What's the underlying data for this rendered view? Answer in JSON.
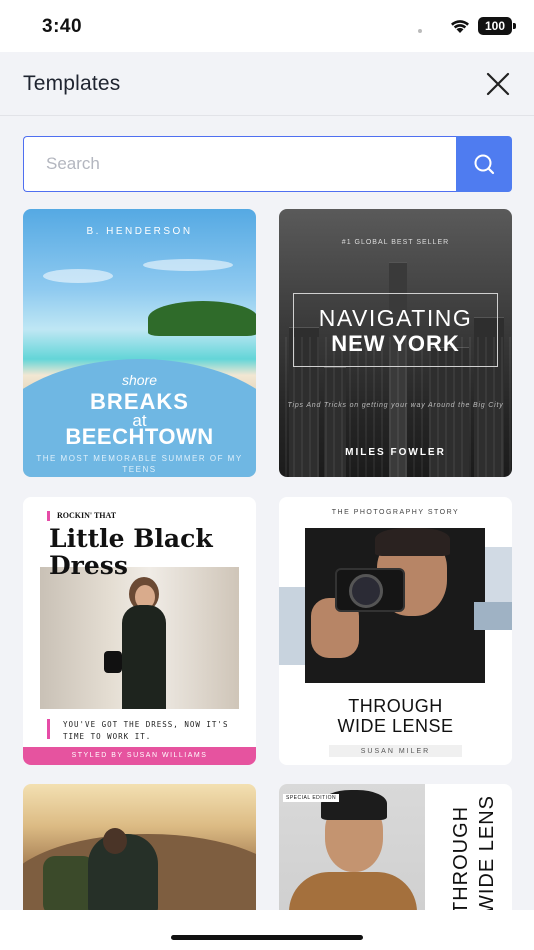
{
  "status_bar": {
    "time": "3:40",
    "battery": "100"
  },
  "header": {
    "title": "Templates"
  },
  "search": {
    "placeholder": "Search",
    "value": ""
  },
  "templates": [
    {
      "author": "B. HENDERSON",
      "line1": "shore",
      "line2": "BREAKS",
      "line3": "at",
      "line4": "BEECHTOWN",
      "tagline": "THE MOST MEMORABLE SUMMER OF MY TEENS"
    },
    {
      "kicker": "#1 GLOBAL BEST SELLER",
      "title1": "NAVIGATING",
      "title2": "NEW YORK",
      "subtitle": "Tips And Tricks on getting your way Around the Big City",
      "author": "MILES FOWLER"
    },
    {
      "kicker": "ROCKIN' THAT",
      "title": "Little Black Dress",
      "body": "YOU'VE GOT THE DRESS, NOW IT'S TIME TO WORK IT.",
      "footer": "STYLED BY SUSAN WILLIAMS"
    },
    {
      "kicker": "THE PHOTOGRAPHY STORY",
      "title1": "THROUGH",
      "title2": "WIDE LENSE",
      "author": "SUSAN MILER"
    },
    {},
    {
      "badge": "SPECIAL EDITION",
      "title1": "THROUGH",
      "title2": "WIDE LENSE"
    }
  ],
  "colors": {
    "accent": "#4f7cf0",
    "pink": "#e6539f",
    "background": "#f2f3f7"
  },
  "icons": {
    "close": "close-icon",
    "search": "search-icon",
    "wifi": "wifi-icon",
    "battery": "battery-icon"
  }
}
